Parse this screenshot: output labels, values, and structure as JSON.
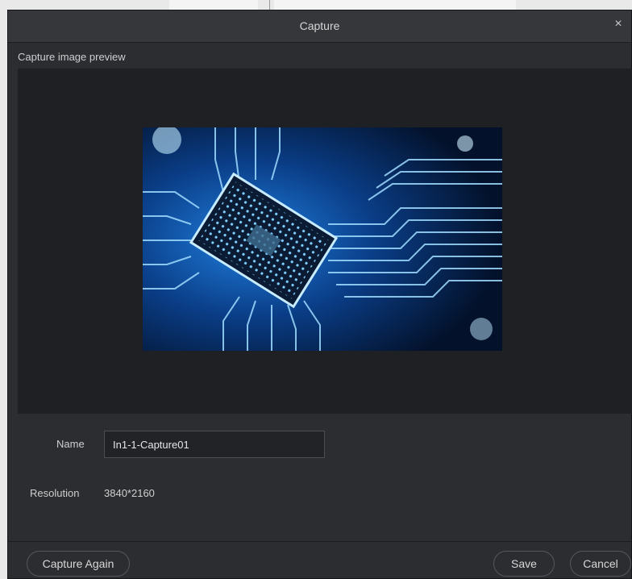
{
  "dialog": {
    "title": "Capture",
    "close_icon": "close-icon",
    "close_glyph": "×"
  },
  "preview": {
    "label": "Capture image preview",
    "image_description_icon": "circuit-chip-image"
  },
  "form": {
    "name_label": "Name",
    "name_value": "In1-1-Capture01",
    "resolution_label": "Resolution",
    "resolution_value": "3840*2160"
  },
  "buttons": {
    "capture_again": "Capture Again",
    "save": "Save",
    "cancel": "Cancel"
  },
  "colors": {
    "dialog_bg": "#2c2d31",
    "preview_bg": "#1f2024",
    "image_accent": "#2aa8ff"
  }
}
